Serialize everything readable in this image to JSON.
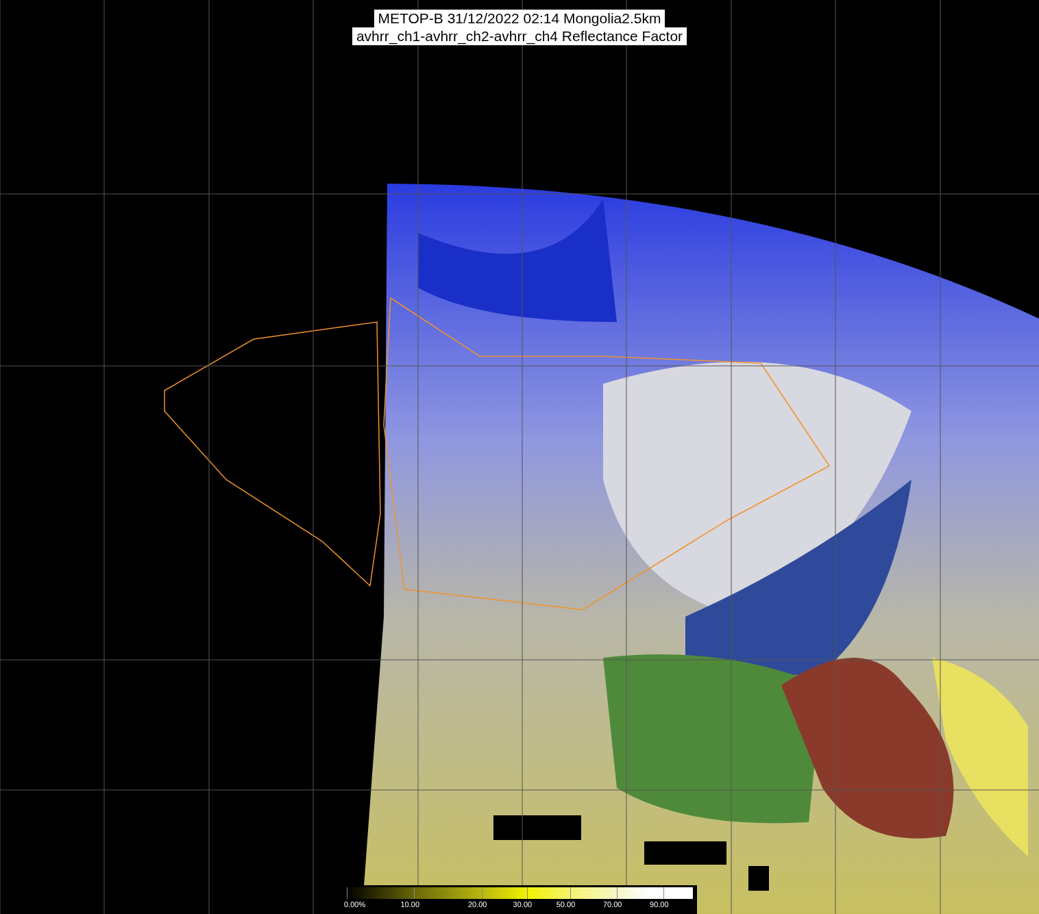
{
  "title": {
    "lines": [
      "METOP-B 31/12/2022 02:14 Mongolia2.5km",
      "avhrr_ch1-avhrr_ch2-avhrr_ch4 Reflectance Factor"
    ]
  },
  "colorbar": {
    "labels": [
      "0.00%",
      "10.00",
      "20.00",
      "30.00",
      "50.00",
      "70.00",
      "90.00"
    ]
  }
}
